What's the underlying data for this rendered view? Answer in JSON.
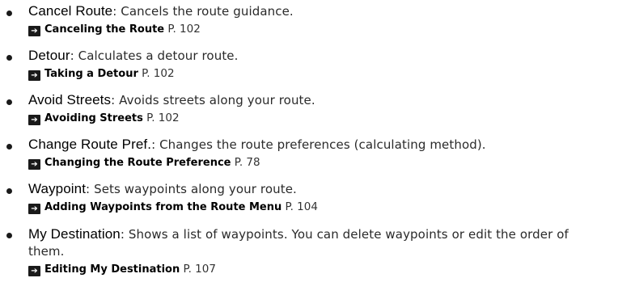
{
  "items": [
    {
      "term": "Cancel Route",
      "desc": ": Cancels the route guidance.",
      "ref_title": "Canceling the Route",
      "ref_page": " P. 102"
    },
    {
      "term": "Detour",
      "desc": ": Calculates a detour route.",
      "ref_title": "Taking a Detour",
      "ref_page": " P. 102"
    },
    {
      "term": "Avoid Streets",
      "desc": ": Avoids streets along your route.",
      "ref_title": "Avoiding Streets",
      "ref_page": " P. 102"
    },
    {
      "term": "Change Route Pref.",
      "desc": ": Changes the route preferences (calculating method).",
      "ref_title": "Changing the Route Preference",
      "ref_page": " P. 78"
    },
    {
      "term": "Waypoint",
      "desc": ": Sets waypoints along your route.",
      "ref_title": "Adding Waypoints from the Route Menu",
      "ref_page": " P. 104"
    },
    {
      "term": "My Destination",
      "desc": ": Shows a list of waypoints. You can delete waypoints or edit the order of them.",
      "ref_title": "Editing My Destination",
      "ref_page": " P. 107"
    }
  ],
  "icons": {
    "reference_arrow": "arrow-right-icon"
  }
}
